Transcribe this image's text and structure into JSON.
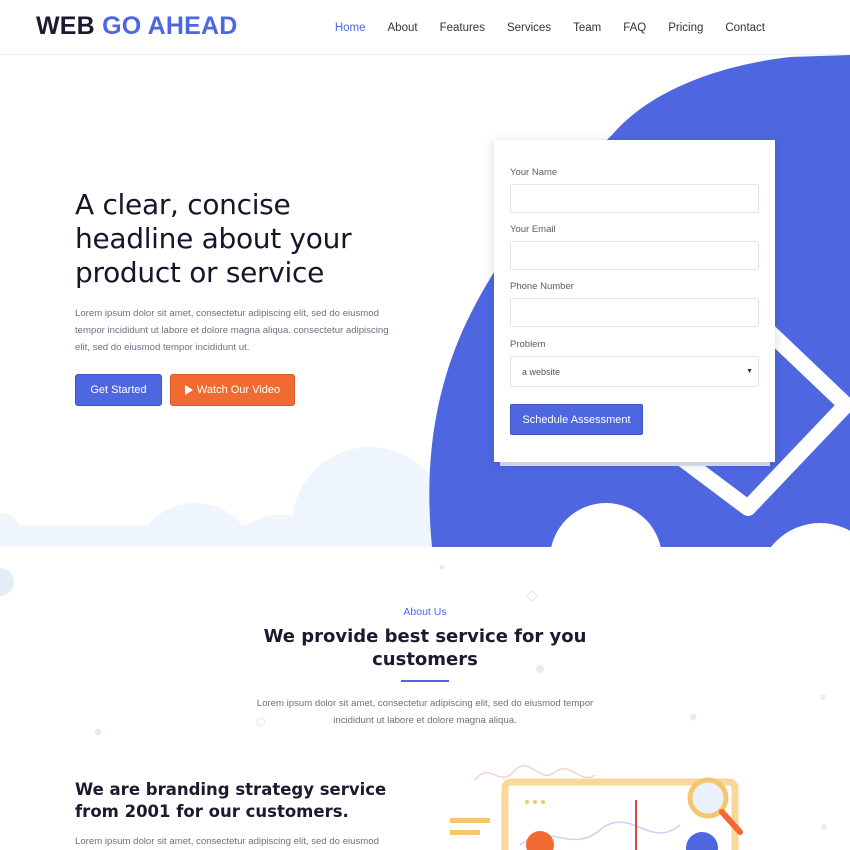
{
  "header": {
    "logo_part1": "WEB",
    "logo_part2": "GO AHEAD",
    "nav": [
      "Home",
      "About",
      "Features",
      "Services",
      "Team",
      "FAQ",
      "Pricing",
      "Contact"
    ],
    "active_nav": "Home"
  },
  "hero": {
    "title": "A clear, concise headline about your product or service",
    "description": "Lorem ipsum dolor sit amet, consectetur adipiscing elit, sed do eiusmod tempor incididunt ut labore et dolore magna aliqua. consectetur adipiscing elit, sed do eiusmod tempor incididunt ut.",
    "btn_primary": "Get Started",
    "btn_secondary": "Watch Our Video"
  },
  "form": {
    "name_label": "Your Name",
    "email_label": "Your Email",
    "phone_label": "Phone Number",
    "problem_label": "Problem",
    "problem_value": "a website",
    "submit": "Schedule Assessment"
  },
  "about": {
    "eyebrow": "About Us",
    "title": "We provide best service for you customers",
    "description": "Lorem ipsum dolor sit amet, consectetur adipiscing elit, sed do eiusmod tempor incididunt ut labore et dolore magna aliqua.",
    "sub_title": "We are branding strategy service from 2001 for our customers.",
    "sub_description": "Lorem ipsum dolor sit amet, consectetur adipiscing elit, sed do eiusmod"
  },
  "colors": {
    "accent": "#4e67e0",
    "orange": "#f06a32",
    "light_blob": "#eef5fd"
  }
}
